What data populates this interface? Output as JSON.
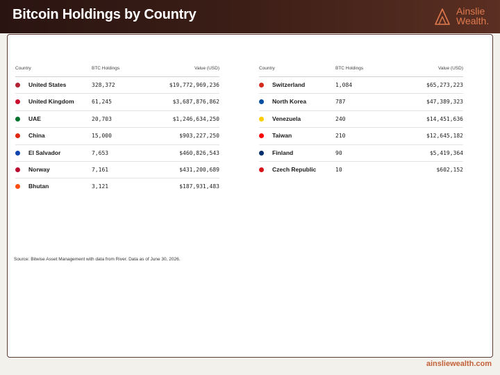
{
  "header": {
    "title": "Bitcoin Holdings by Country",
    "logo_line1": "Ainslie",
    "logo_line2": "Wealth."
  },
  "columns": {
    "country": "Country",
    "holdings": "BTC Holdings",
    "value": "Value (USD)"
  },
  "tables": [
    {
      "rows": [
        {
          "country": "United States",
          "holdings": "328,372",
          "value": "$19,772,969,236",
          "flag_color": "#b22234"
        },
        {
          "country": "United Kingdom",
          "holdings": "61,245",
          "value": "$3,687,876,862",
          "flag_color": "#c8102e"
        },
        {
          "country": "UAE",
          "holdings": "20,703",
          "value": "$1,246,634,250",
          "flag_color": "#00732f"
        },
        {
          "country": "China",
          "holdings": "15,000",
          "value": "$903,227,250",
          "flag_color": "#de2910"
        },
        {
          "country": "El Salvador",
          "holdings": "7,653",
          "value": "$460,826,543",
          "flag_color": "#0f47af"
        },
        {
          "country": "Norway",
          "holdings": "7,161",
          "value": "$431,200,689",
          "flag_color": "#ba0c2f"
        },
        {
          "country": "Bhutan",
          "holdings": "3,121",
          "value": "$187,931,483",
          "flag_color": "#ff4e12"
        }
      ]
    },
    {
      "rows": [
        {
          "country": "Switzerland",
          "holdings": "1,084",
          "value": "$65,273,223",
          "flag_color": "#d52b1e"
        },
        {
          "country": "North Korea",
          "holdings": "787",
          "value": "$47,389,323",
          "flag_color": "#024fa2"
        },
        {
          "country": "Venezuela",
          "holdings": "240",
          "value": "$14,451,636",
          "flag_color": "#ffcc00"
        },
        {
          "country": "Taiwan",
          "holdings": "210",
          "value": "$12,645,182",
          "flag_color": "#fe0000"
        },
        {
          "country": "Finland",
          "holdings": "90",
          "value": "$5,419,364",
          "flag_color": "#002f6c"
        },
        {
          "country": "Czech Republic",
          "holdings": "10",
          "value": "$602,152",
          "flag_color": "#d7141a"
        }
      ]
    }
  ],
  "source": "Source: Bitwise Asset Management with data from River. Data as of June 30, 2026.",
  "footer": {
    "url": "ainsliewealth.com"
  },
  "colors": {
    "header_dark": "#2a1411",
    "accent": "#e07a4e",
    "footer_url": "#c2613a"
  }
}
